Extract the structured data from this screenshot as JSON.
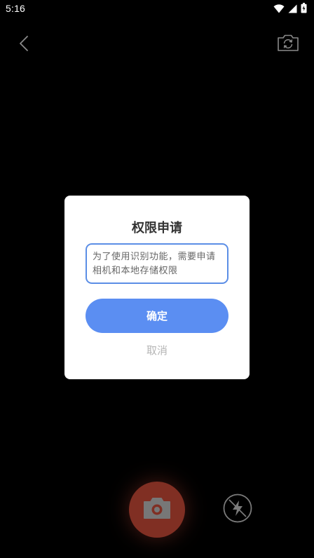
{
  "status_bar": {
    "time": "5:16",
    "icons": [
      "wifi-icon",
      "signal-icon",
      "battery-icon"
    ]
  },
  "top_bar": {
    "back_icon": "chevron-left-icon",
    "flip_icon": "camera-flip-icon"
  },
  "dialog": {
    "title": "权限申请",
    "message": "为了使用识别功能，需要申请相机和本地存储权限",
    "confirm_label": "确定",
    "cancel_label": "取消",
    "accent_color": "#5b8ef2"
  },
  "bottom_controls": {
    "shutter_icon": "camera-icon",
    "shutter_color": "#e8553f",
    "flash_icon": "flash-off-icon"
  }
}
